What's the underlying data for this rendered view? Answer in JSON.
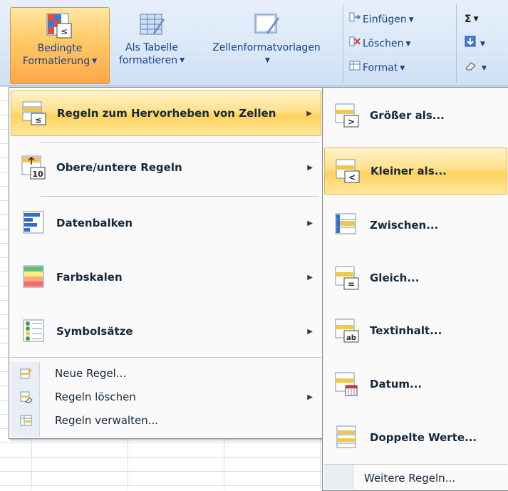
{
  "ribbon": {
    "cond_format": {
      "line1": "Bedingte",
      "line2": "Formatierung"
    },
    "as_table": {
      "line1": "Als Tabelle",
      "line2": "formatieren"
    },
    "cell_styles": {
      "line1": "Zellenformatvorlagen"
    },
    "cells": {
      "insert": "Einfügen",
      "delete": "Löschen",
      "format": "Format"
    },
    "editing": {
      "sum": "Σ"
    }
  },
  "left_menu": {
    "items": [
      {
        "label": "Regeln zum Hervorheben von Zellen",
        "icon": "highlight-rules-icon"
      },
      {
        "label": "Obere/untere Regeln",
        "icon": "top-bottom-rules-icon"
      },
      {
        "label": "Datenbalken",
        "icon": "data-bars-icon"
      },
      {
        "label": "Farbskalen",
        "icon": "color-scales-icon"
      },
      {
        "label": "Symbolsätze",
        "icon": "icon-sets-icon"
      }
    ],
    "small_items": [
      {
        "label": "Neue Regel...",
        "icon": "new-rule-icon"
      },
      {
        "label": "Regeln löschen",
        "icon": "clear-rules-icon"
      },
      {
        "label": "Regeln verwalten...",
        "icon": "manage-rules-icon"
      }
    ]
  },
  "right_menu": {
    "items": [
      {
        "label": "Größer als...",
        "icon": "greater-than-icon"
      },
      {
        "label": "Kleiner als...",
        "icon": "less-than-icon"
      },
      {
        "label": "Zwischen...",
        "icon": "between-icon"
      },
      {
        "label": "Gleich...",
        "icon": "equal-to-icon"
      },
      {
        "label": "Textinhalt...",
        "icon": "text-contains-icon"
      },
      {
        "label": "Datum...",
        "icon": "date-occurring-icon"
      },
      {
        "label": "Doppelte Werte...",
        "icon": "duplicate-values-icon"
      }
    ],
    "more": "Weitere Regeln..."
  }
}
